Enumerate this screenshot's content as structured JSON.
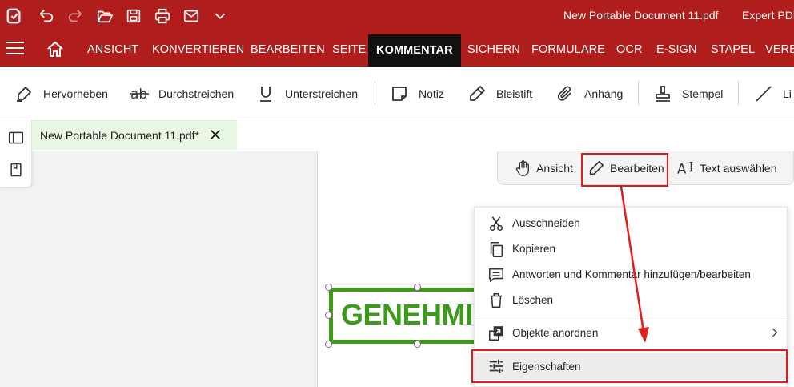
{
  "window": {
    "document_title": "New Portable Document 11.pdf",
    "app_name": "Expert PDF"
  },
  "menu": {
    "items": [
      {
        "label": "ANSICHT"
      },
      {
        "label": "KONVERTIEREN"
      },
      {
        "label": "BEARBEITEN"
      },
      {
        "label": "SEITE"
      },
      {
        "label": "KOMMENTAR",
        "active": true
      },
      {
        "label": "SICHERN"
      },
      {
        "label": "FORMULARE"
      },
      {
        "label": "OCR"
      },
      {
        "label": "E-SIGN"
      },
      {
        "label": "STAPEL"
      },
      {
        "label": "VERB"
      }
    ]
  },
  "ribbon": {
    "hervorheben": "Hervorheben",
    "durchstreichen": "Durchstreichen",
    "unterstreichen": "Unterstreichen",
    "notiz": "Notiz",
    "bleistift": "Bleistift",
    "anhang": "Anhang",
    "stempel": "Stempel",
    "linie": "Li"
  },
  "tab": {
    "label": "New Portable Document 11.pdf*"
  },
  "modebar": {
    "ansicht": "Ansicht",
    "bearbeiten": "Bearbeiten",
    "text_auswaehlen": "Text auswählen"
  },
  "stamp": {
    "text": "GENEHMIG"
  },
  "context_menu": {
    "ausschneiden": "Ausschneiden",
    "kopieren": "Kopieren",
    "antworten": "Antworten und Kommentar hinzufügen/bearbeiten",
    "loeschen": "Löschen",
    "objekte_anordnen": "Objekte anordnen",
    "eigenschaften": "Eigenschaften"
  },
  "colors": {
    "brand": "#b01d1d",
    "active_tab": "#111111",
    "stamp_green": "#3d9b1a",
    "annotation_red": "#e21b1b",
    "tab_bg": "#e8f7e4"
  }
}
